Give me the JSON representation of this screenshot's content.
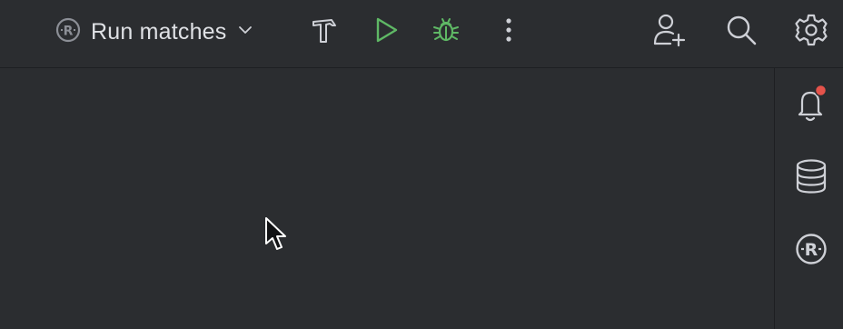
{
  "toolbar": {
    "run_config_label": "Run matches",
    "icons": {
      "run_config": "rust-r-logo-icon",
      "dropdown": "chevron-down-icon",
      "build": "hammer-icon",
      "run": "play-icon",
      "debug": "bug-icon",
      "more": "more-vertical-icon",
      "add_user": "add-user-icon",
      "search": "search-icon",
      "settings": "gear-icon"
    }
  },
  "right_sidebar": {
    "icons": {
      "notifications": "bell-icon",
      "database": "database-icon",
      "rust": "rust-r-logo-icon"
    }
  },
  "colors": {
    "background": "#2b2d30",
    "icon": "#ced0d6",
    "run_green": "#5fb865",
    "notification_dot": "#e5534b"
  }
}
